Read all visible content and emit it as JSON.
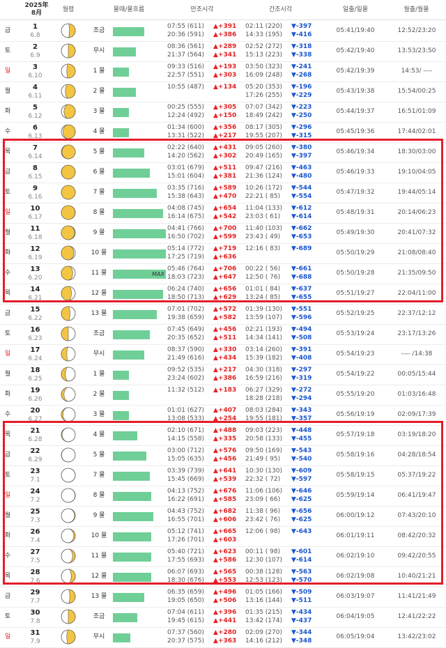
{
  "header": {
    "year_month": "2025年\n8月",
    "moon_phase": "월령",
    "tide_flow": "물때/물흐름",
    "high_tide": "만조시각",
    "low_tide": "간조시각",
    "sunrise_set": "일출/일몰",
    "moonrise_set": "월출/월몰"
  },
  "colors": {
    "high": "#e32222",
    "low": "#1a55cc",
    "bar": "#6fcf97",
    "highlight": "#e31d2a"
  },
  "rows": [
    {
      "wd": "금",
      "day": "1",
      "lunar": "6.8",
      "phase": 0.45,
      "mul": "조금",
      "bar": 45,
      "high": [
        "07:55 (611) ▲+391",
        "20:36 (591) ▲+386"
      ],
      "low": [
        "02:11 (220) ▼-397",
        "14:33 (195) ▼-416"
      ],
      "sun": "05:41/19:40",
      "moon": "12:52/23:20"
    },
    {
      "wd": "토",
      "day": "2",
      "lunar": "6.9",
      "phase": 0.5,
      "mul": "무시",
      "bar": 33,
      "high": [
        "08:36 (561) ▲+289",
        "21:37 (564) ▲+341"
      ],
      "low": [
        "02:52 (272) ▼-318",
        "15:13 (223) ▼-338"
      ],
      "sun": "05:42/19:40",
      "moon": "13:53/23:50"
    },
    {
      "wd": "일",
      "day": "3",
      "lunar": "6.10",
      "phase": 0.57,
      "mul": "1 물",
      "bar": 23,
      "high": [
        "09:33 (516) ▲+193",
        "22:57 (551) ▲+303"
      ],
      "low": [
        "03:50 (323) ▼-241",
        "16:09 (248) ▼-268"
      ],
      "sun": "05:42/19:39",
      "moon": "14:53/ ----"
    },
    {
      "wd": "월",
      "day": "4",
      "lunar": "6.11",
      "phase": 0.64,
      "mul": "2 물",
      "bar": 33,
      "high": [
        "10:55 (487) ▲+134",
        ""
      ],
      "low": [
        "05:20 (353) ▼-196",
        "17:26 (255) ▼-229"
      ],
      "sun": "05:43/19:38",
      "moon": "15:54/00:25"
    },
    {
      "wd": "화",
      "day": "5",
      "lunar": "6.12",
      "phase": 0.71,
      "mul": "3 물",
      "bar": 23,
      "high": [
        "00:25 (555) ▲+305",
        "12:24 (492) ▲+150"
      ],
      "low": [
        "07:07 (342) ▼-223",
        "18:49 (242) ▼-250"
      ],
      "sun": "05:44/19:37",
      "moon": "16:51/01:09"
    },
    {
      "wd": "수",
      "day": "6",
      "lunar": "6.13",
      "phase": 0.78,
      "mul": "4 물",
      "bar": 23,
      "high": [
        "01:34 (600) ▲+356",
        "13:31 (522) ▲+217"
      ],
      "low": [
        "08:17 (305) ▼-296",
        "19:55 (207) ▼-315"
      ],
      "sun": "05:45/19:36",
      "moon": "17:44/02:01"
    },
    {
      "wd": "목",
      "day": "7",
      "lunar": "6.14",
      "phase": 0.86,
      "mul": "5 물",
      "bar": 45,
      "high": [
        "02:22 (640) ▲+431",
        "14:20 (562) ▲+302"
      ],
      "low": [
        "09:05 (260) ▼-380",
        "20:49 (165) ▼-397"
      ],
      "sun": "05:46/19:34",
      "moon": "18:30/03:00"
    },
    {
      "wd": "금",
      "day": "8",
      "lunar": "6.15",
      "phase": 0.93,
      "mul": "6 물",
      "bar": 53,
      "high": [
        "03:01 (679) ▲+511",
        "15:01 (604) ▲+381"
      ],
      "low": [
        "09:47 (216) ▼-463",
        "21:36 (124) ▼-480"
      ],
      "sun": "05:46/19:33",
      "moon": "19:10/04:05"
    },
    {
      "wd": "토",
      "day": "9",
      "lunar": "6.16",
      "phase": 1.0,
      "mul": "7 물",
      "bar": 63,
      "high": [
        "03:35 (716) ▲+589",
        "15:38 (643) ▲+470"
      ],
      "low": [
        "10:26 (172) ▼-544",
        "22:21 ( 85) ▼-554"
      ],
      "sun": "05:47/19:32",
      "moon": "19:44/05:14"
    },
    {
      "wd": "일",
      "day": "10",
      "lunar": "6.17",
      "phase": 1.07,
      "mul": "8 물",
      "bar": 72,
      "high": [
        "04:08 (745) ▲+654",
        "16:14 (675) ▲+542"
      ],
      "low": [
        "11:04 (133) ▼-612",
        "23:03 ( 61) ▼-614"
      ],
      "sun": "05:48/19:31",
      "moon": "20:14/06:23"
    },
    {
      "wd": "월",
      "day": "11",
      "lunar": "6.18",
      "phase": 1.14,
      "mul": "9 물",
      "bar": 76,
      "high": [
        "04:41 (766) ▲+700",
        "16:50 (702) ▲+599"
      ],
      "low": [
        "11:40 (103) ▼-662",
        "23:43 ( 49) ▼-653"
      ],
      "sun": "05:49/19:30",
      "moon": "20:41/07:32"
    },
    {
      "wd": "화",
      "day": "12",
      "lunar": "6.19",
      "phase": 1.21,
      "mul": "10 물",
      "bar": 76,
      "high": [
        "05:14 (772) ▲+719",
        "17:25 (719) ▲+636"
      ],
      "low": [
        "12:16 ( 83) ▼-689",
        ""
      ],
      "sun": "05:50/19:29",
      "moon": "21:08/08:40"
    },
    {
      "wd": "수",
      "day": "13",
      "lunar": "6.20",
      "phase": 1.28,
      "mul": "11 물",
      "bar": 76,
      "max": "MAX",
      "high": [
        "05:46 (764) ▲+706",
        "18:03 (723) ▲+647"
      ],
      "low": [
        "00:22 ( 56) ▼-661",
        "12:50 ( 76) ▼-688"
      ],
      "sun": "05:50/19:28",
      "moon": "21:35/09:50"
    },
    {
      "wd": "목",
      "day": "14",
      "lunar": "6.21",
      "phase": 1.35,
      "mul": "12 물",
      "bar": 72,
      "high": [
        "06:24 (740) ▲+656",
        "18:50 (713) ▲+629"
      ],
      "low": [
        "01:01 ( 84) ▼-637",
        "13:24 ( 85) ▼-655"
      ],
      "sun": "05:51/19:27",
      "moon": "22:04/11:00"
    },
    {
      "wd": "금",
      "day": "15",
      "lunar": "6.22",
      "phase": 1.42,
      "mul": "13 물",
      "bar": 63,
      "high": [
        "07:01 (702) ▲+572",
        "19:38 (659) ▲+582"
      ],
      "low": [
        "01:39 (130) ▼-551",
        "13:59 (107) ▼-596"
      ],
      "sun": "05:52/19:25",
      "moon": "22:37/12:12"
    },
    {
      "wd": "토",
      "day": "16",
      "lunar": "6.23",
      "phase": 1.5,
      "mul": "조금",
      "bar": 53,
      "high": [
        "07:45 (649) ▲+456",
        "20:35 (652) ▲+511"
      ],
      "low": [
        "02:21 (193) ▼-494",
        "14:34 (141) ▼-508"
      ],
      "sun": "05:53/19:24",
      "moon": "23:17/13:26"
    },
    {
      "wd": "일",
      "day": "17",
      "lunar": "6.24",
      "phase": 1.57,
      "mul": "무시",
      "bar": 45,
      "high": [
        "08:37 (590) ▲+330",
        "21:49 (616) ▲+434"
      ],
      "low": [
        "03:14 (260) ▼-391",
        "15:39 (182) ▼-408"
      ],
      "sun": "05:54/19:23",
      "moon": "---- /14:38"
    },
    {
      "wd": "월",
      "day": "18",
      "lunar": "6.25",
      "phase": 1.64,
      "mul": "1 물",
      "bar": 23,
      "high": [
        "09:52 (535) ▲+217",
        "23:24 (602) ▲+386"
      ],
      "low": [
        "04:30 (318) ▼-297",
        "16:59 (216) ▼-319"
      ],
      "sun": "05:54/19:22",
      "moon": "00:05/15:44"
    },
    {
      "wd": "화",
      "day": "19",
      "lunar": "6.26",
      "phase": 1.71,
      "mul": "2 물",
      "bar": 23,
      "high": [
        "11:32 (512) ▲+183",
        ""
      ],
      "low": [
        "06:27 (329) ▼-272",
        "18:28 (218) ▼-294"
      ],
      "sun": "05:55/19:20",
      "moon": "01:03/16:48"
    },
    {
      "wd": "수",
      "day": "20",
      "lunar": "6.27",
      "phase": 1.78,
      "mul": "3 물",
      "bar": 23,
      "high": [
        "01:01 (627) ▲+407",
        "13:08 (533) ▲+254"
      ],
      "low": [
        "08:03 (284) ▼-343",
        "19:55 (181) ▼-357"
      ],
      "sun": "05:56/19:19",
      "moon": "02:09/17:39"
    },
    {
      "wd": "목",
      "day": "21",
      "lunar": "6.28",
      "phase": 1.85,
      "mul": "4 물",
      "bar": 35,
      "high": [
        "02:10 (671) ▲+488",
        "14:15 (558) ▲+335"
      ],
      "low": [
        "09:03 (223) ▼-448",
        "20:58 (133) ▼-455"
      ],
      "sun": "05:57/19:18",
      "moon": "03:19/18:20"
    },
    {
      "wd": "금",
      "day": "22",
      "lunar": "6.29",
      "phase": 1.92,
      "mul": "5 물",
      "bar": 48,
      "high": [
        "03:00 (712) ▲+576",
        "15:05 (635) ▲+456"
      ],
      "low": [
        "09:50 (169) ▼-543",
        "21:49 ( 95) ▼-540"
      ],
      "sun": "05:58/19:16",
      "moon": "04:28/18:54"
    },
    {
      "wd": "토",
      "day": "23",
      "lunar": "7.1",
      "phase": 0.02,
      "mul": "7 물",
      "bar": 53,
      "high": [
        "03:39 (739) ▲+641",
        "15:45 (669) ▲+539"
      ],
      "low": [
        "10:30 (130) ▼-609",
        "22:32 ( 72) ▼-597"
      ],
      "sun": "05:58/19:15",
      "moon": "05:37/19:22"
    },
    {
      "wd": "일",
      "day": "24",
      "lunar": "7.2",
      "phase": 0.08,
      "mul": "8 물",
      "bar": 55,
      "high": [
        "04:13 (752) ▲+676",
        "16:22 (691) ▲+585"
      ],
      "low": [
        "11:06 (106) ▼-646",
        "23:09 ( 66) ▼-625"
      ],
      "sun": "05:59/19:14",
      "moon": "06:41/19:47"
    },
    {
      "wd": "월",
      "day": "25",
      "lunar": "7.3",
      "phase": 0.15,
      "mul": "9 물",
      "bar": 58,
      "high": [
        "04:43 (752) ▲+682",
        "16:55 (701) ▲+606"
      ],
      "low": [
        "11:38 ( 96) ▼-656",
        "23:42 ( 76) ▼-625"
      ],
      "sun": "06:00/19:12",
      "moon": "07:43/20:10"
    },
    {
      "wd": "화",
      "day": "26",
      "lunar": "7.4",
      "phase": 0.22,
      "mul": "10 물",
      "bar": 55,
      "high": [
        "05:12 (741) ▲+665",
        "17:26 (701) ▲+603"
      ],
      "low": [
        "12:06 ( 98) ▼-643",
        ""
      ],
      "sun": "06:01/19:11",
      "moon": "08:42/20:32"
    },
    {
      "wd": "수",
      "day": "27",
      "lunar": "7.5",
      "phase": 0.29,
      "mul": "11 물",
      "bar": 55,
      "high": [
        "05:40 (721) ▲+623",
        "17:55 (693) ▲+586"
      ],
      "low": [
        "00:11 ( 98) ▼-601",
        "12:30 (107) ▼-614"
      ],
      "sun": "06:02/19:10",
      "moon": "09:42/20:55"
    },
    {
      "wd": "목",
      "day": "28",
      "lunar": "7.6",
      "phase": 0.36,
      "mul": "12 물",
      "bar": 55,
      "high": [
        "06:07 (693) ▲+565",
        "18:30 (676) ▲+553"
      ],
      "low": [
        "00:38 (128) ▼-563",
        "12:53 (123) ▼-570"
      ],
      "sun": "06:02/19:08",
      "moon": "10:40/21:21"
    },
    {
      "wd": "금",
      "day": "29",
      "lunar": "7.7",
      "phase": 0.43,
      "mul": "13 물",
      "bar": 45,
      "high": [
        "06:35 (659) ▲+496",
        "19:05 (650) ▲+506"
      ],
      "low": [
        "01:05 (166) ▼-509",
        "13:16 (144) ▼-511"
      ],
      "sun": "06:03/19:07",
      "moon": "11:41/21:49"
    },
    {
      "wd": "토",
      "day": "30",
      "lunar": "7.8",
      "phase": 0.5,
      "mul": "조금",
      "bar": 35,
      "high": [
        "07:04 (611) ▲+396",
        "19:45 (615) ▲+441"
      ],
      "low": [
        "01:35 (215) ▼-434",
        "13:42 (174) ▼-437"
      ],
      "sun": "06:04/19:05",
      "moon": "12:41/22:22"
    },
    {
      "wd": "일",
      "day": "31",
      "lunar": "7.9",
      "phase": 0.57,
      "mul": "무시",
      "bar": 25,
      "high": [
        "07:37 (560) ▲+280",
        "20:37 (575) ▲+363"
      ],
      "low": [
        "02:09 (270) ▼-344",
        "14:16 (212) ▼-348"
      ],
      "sun": "06:05/19:04",
      "moon": "13:42/23:02"
    }
  ]
}
